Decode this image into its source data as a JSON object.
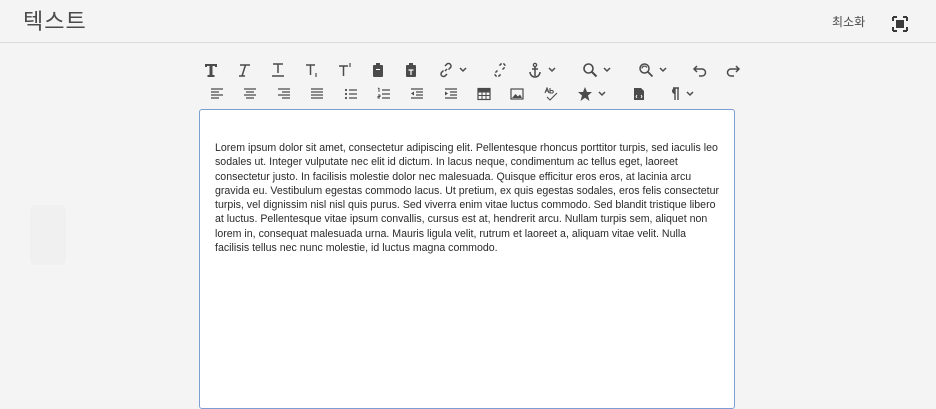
{
  "header": {
    "title": "텍스트",
    "minimize_label": "최소화"
  },
  "toolbar": {
    "row1": [
      "bold-icon",
      "italic-icon",
      "underline-icon",
      "subscript-icon",
      "superscript-icon",
      "paste-icon",
      "paste-plain-icon",
      "link-icon",
      "unlink-icon",
      "anchor-icon",
      "find-icon",
      "find-replace-icon",
      "undo-icon",
      "redo-icon"
    ],
    "row2": [
      "align-left-icon",
      "align-center-icon",
      "align-right-icon",
      "align-justify-icon",
      "bullet-list-icon",
      "numbered-list-icon",
      "outdent-icon",
      "indent-icon",
      "table-icon",
      "image-icon",
      "spellcheck-icon",
      "special-char-icon",
      "source-edit-icon",
      "paragraph-format-icon"
    ]
  },
  "editor": {
    "content": "Lorem ipsum dolor sit amet, consectetur adipiscing elit. Pellentesque rhoncus porttitor turpis, sed iaculis leo sodales ut. Integer vulputate nec elit id dictum. In lacus neque, condimentum ac tellus eget, laoreet consectetur justo. In facilisis molestie dolor nec malesuada. Quisque efficitur eros eros, at lacinia arcu gravida eu. Vestibulum egestas commodo lacus. Ut pretium, ex quis egestas sodales, eros felis consectetur turpis, vel dignissim nisl nisl quis purus. Sed viverra enim vitae luctus commodo. Sed blandit tristique libero at luctus. Pellentesque vitae ipsum convallis, cursus est at, hendrerit arcu. Nullam turpis sem, aliquet non lorem in, consequat malesuada urna. Mauris ligula velit, rutrum et laoreet a, aliquam vitae velit. Nulla facilisis tellus nec nunc molestie, id luctus magna commodo."
  },
  "colors": {
    "background": "#f4f4f4",
    "editor_border": "#7c9fd3",
    "icon": "#4b4b4b"
  }
}
